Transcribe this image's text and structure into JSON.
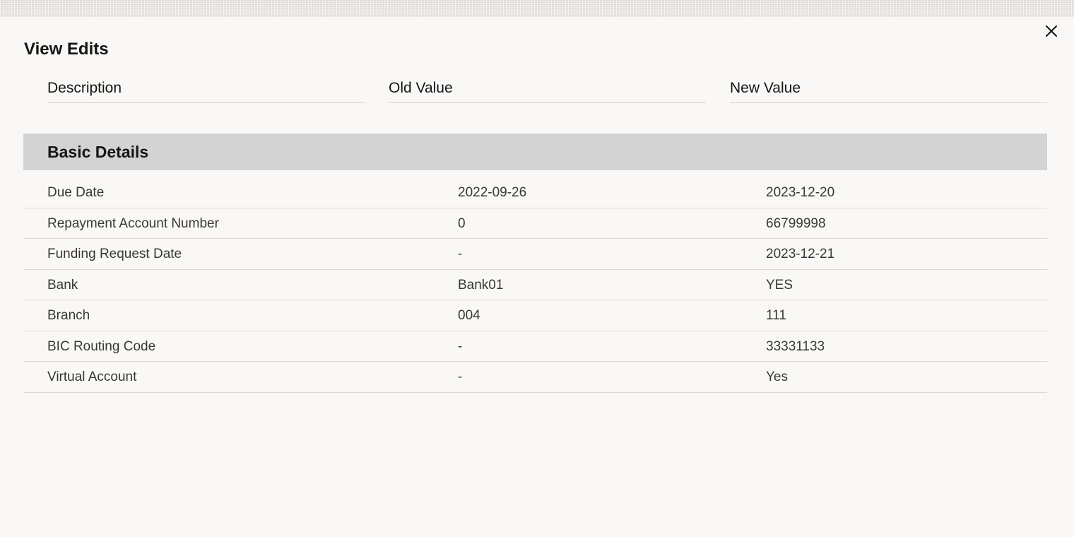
{
  "dialog": {
    "title": "View Edits",
    "close_icon": "close-icon"
  },
  "columns": {
    "description": "Description",
    "old_value": "Old Value",
    "new_value": "New Value"
  },
  "section": {
    "title": "Basic Details"
  },
  "rows": [
    {
      "description": "Due Date",
      "old_value": "2022-09-26",
      "new_value": "2023-12-20"
    },
    {
      "description": "Repayment Account Number",
      "old_value": "0",
      "new_value": "66799998"
    },
    {
      "description": "Funding Request Date",
      "old_value": "-",
      "new_value": "2023-12-21"
    },
    {
      "description": "Bank",
      "old_value": "Bank01",
      "new_value": "YES"
    },
    {
      "description": "Branch",
      "old_value": "004",
      "new_value": "111"
    },
    {
      "description": "BIC Routing Code",
      "old_value": "-",
      "new_value": "33331133"
    },
    {
      "description": "Virtual Account",
      "old_value": "-",
      "new_value": "Yes"
    }
  ]
}
